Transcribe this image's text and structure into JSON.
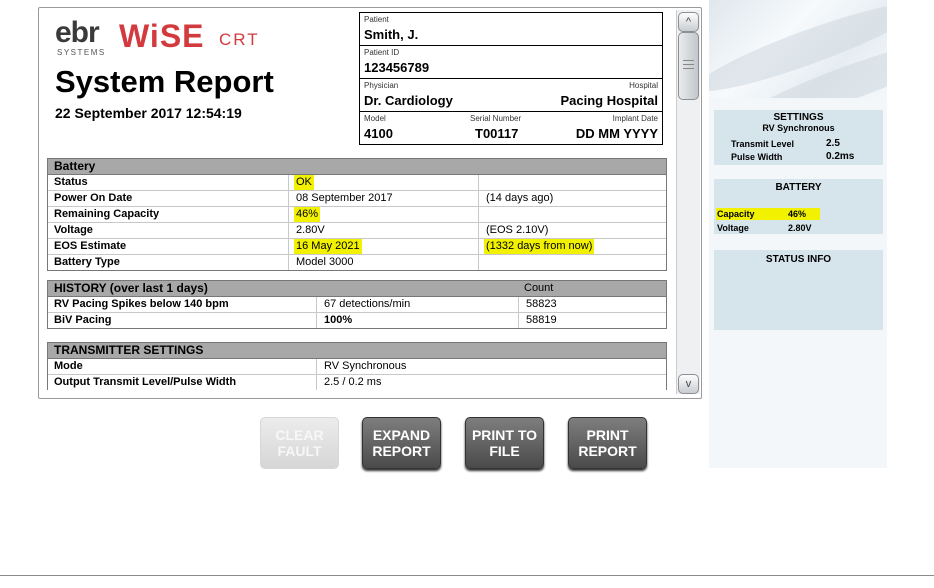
{
  "logo": {
    "ebr": "ebr",
    "systems": "SYSTEMS",
    "wise": "WiSE",
    "crt": "CRT"
  },
  "report": {
    "title": "System Report",
    "date": "22 September 2017 12:54:19"
  },
  "patient": {
    "patient_label": "Patient",
    "patient_value": "Smith, J.",
    "id_label": "Patient ID",
    "id_value": "123456789",
    "physician_label": "Physician",
    "physician_value": "Dr. Cardiology",
    "hospital_label": "Hospital",
    "hospital_value": "Pacing Hospital",
    "model_label": "Model",
    "model_value": "4100",
    "serial_label": "Serial Number",
    "serial_value": "T00117",
    "implant_label": "Implant Date",
    "implant_value": "DD MM YYYY"
  },
  "battery": {
    "header": "Battery",
    "rows": [
      {
        "label": "Status",
        "value": "OK",
        "extra": ""
      },
      {
        "label": "Power On Date",
        "value": "08 September 2017",
        "extra": "(14 days ago)"
      },
      {
        "label": "Remaining Capacity",
        "value": "46%",
        "extra": ""
      },
      {
        "label": "Voltage",
        "value": "2.80V",
        "extra": "(EOS 2.10V)"
      },
      {
        "label": "EOS Estimate",
        "value": "16 May 2021",
        "extra": "(1332 days from now)"
      },
      {
        "label": "Battery Type",
        "value": "Model 3000",
        "extra": ""
      }
    ]
  },
  "history": {
    "header": "HISTORY (over last 1 days)",
    "count_header": "Count",
    "rows": [
      {
        "label": "RV Pacing Spikes below 140 bpm",
        "value": "67 detections/min",
        "count": "58823"
      },
      {
        "label": "BiV Pacing",
        "value": "100%",
        "count": "58819"
      }
    ]
  },
  "transmitter": {
    "header": "TRANSMITTER SETTINGS",
    "rows": [
      {
        "label": "Mode",
        "value": "RV Synchronous"
      },
      {
        "label": "Output Transmit Level/Pulse Width",
        "value": "2.5 / 0.2 ms"
      }
    ]
  },
  "scrollbar": {
    "up": "^",
    "down": "v"
  },
  "buttons": {
    "clear_fault": "CLEAR FAULT",
    "expand_report": "EXPAND REPORT",
    "print_to_file": "PRINT TO FILE",
    "print_report": "PRINT REPORT"
  },
  "side": {
    "settings": {
      "title": "SETTINGS",
      "mode": "RV Synchronous",
      "transmit_label": "Transmit Level",
      "transmit_value": "2.5",
      "pulse_label": "Pulse Width",
      "pulse_value": "0.2ms"
    },
    "battery": {
      "title": "BATTERY",
      "capacity_label": "Capacity",
      "capacity_value": "46%",
      "voltage_label": "Voltage",
      "voltage_value": "2.80V"
    },
    "status": {
      "title": "STATUS INFO"
    }
  },
  "colors": {
    "brand_red": "#d23a3e",
    "highlight": "#f2f200",
    "side_panel": "#d6e4ec",
    "header_gray": "#a8a8a8"
  }
}
